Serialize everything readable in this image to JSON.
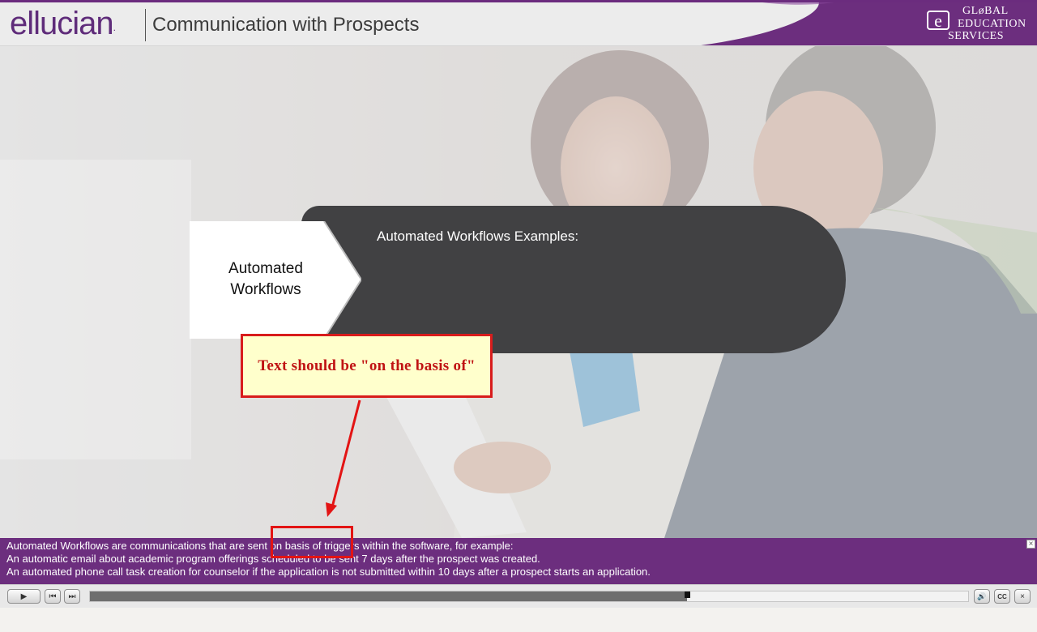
{
  "header": {
    "brand": "ellucian",
    "brand_mark": ".",
    "course_title": "Communication with Prospects",
    "logo": {
      "mark": "e",
      "line1": "GLøBAL",
      "line2": "EDUCATION",
      "line3": "SERVICES"
    }
  },
  "slide": {
    "tab_label": "Automated Workflows",
    "heading": "Automated Workflows Examples:"
  },
  "annotation": {
    "note": "Text should be \"on the basis of\""
  },
  "captions": {
    "lines": [
      "Automated Workflows are communications that are sent on basis of triggers within the software, for example:",
      "An automatic email about academic program offerings scheduled to be sent 7 days after the prospect was created.",
      "An automated phone call task creation for counselor if the application is not submitted within 10 days after a prospect starts an application."
    ],
    "close": "×"
  },
  "player": {
    "progress": 0.68,
    "buttons": {
      "play": "▶",
      "prev": "⏮",
      "next": "⏭",
      "volume": "🔊",
      "cc": "CC",
      "close": "×"
    }
  },
  "colors": {
    "brand_purple": "#6c2e7e",
    "annotation_red": "#d81c1c",
    "note_bg": "#ffffcc",
    "pill_dark": "#414143"
  }
}
